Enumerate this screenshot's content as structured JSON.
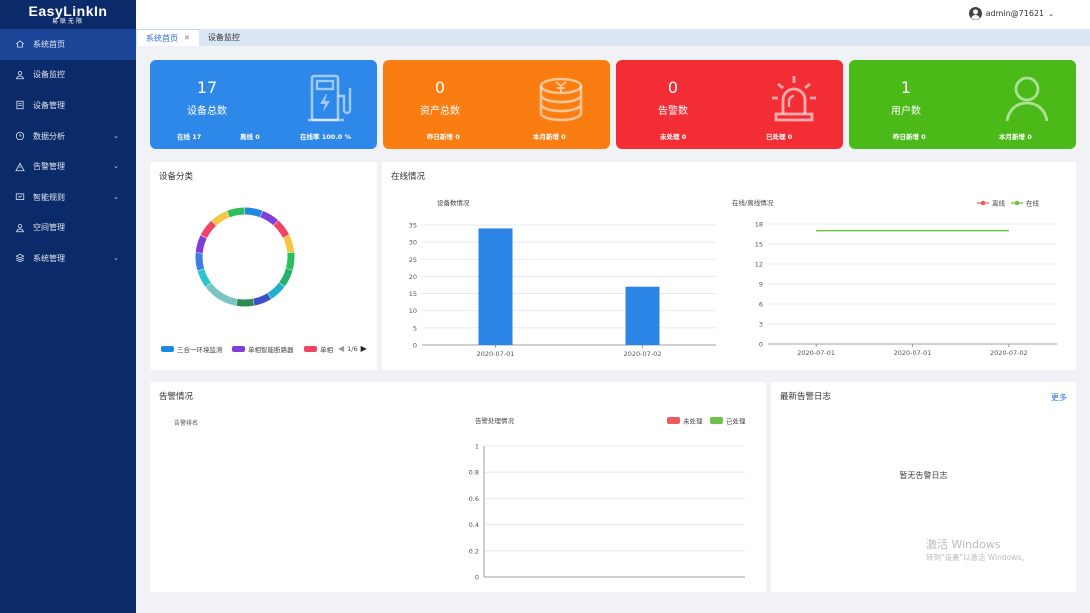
{
  "logo": {
    "main": "EasyLinkIn",
    "sub": "易联无限"
  },
  "sidebar": {
    "items": [
      {
        "label": "系统首页",
        "icon": "home-icon",
        "has_children": false,
        "active": true
      },
      {
        "label": "设备监控",
        "icon": "user-icon",
        "has_children": false
      },
      {
        "label": "设备管理",
        "icon": "document-icon",
        "has_children": false
      },
      {
        "label": "数据分析",
        "icon": "clock-icon",
        "has_children": true
      },
      {
        "label": "告警管理",
        "icon": "warning-icon",
        "has_children": true
      },
      {
        "label": "智能规则",
        "icon": "monitor-icon",
        "has_children": true
      },
      {
        "label": "空间管理",
        "icon": "user-icon",
        "has_children": false
      },
      {
        "label": "系统管理",
        "icon": "layers-icon",
        "has_children": true
      }
    ]
  },
  "header": {
    "user": "admin@71621"
  },
  "tabs": [
    {
      "label": "系统首页",
      "closable": true,
      "active": true
    },
    {
      "label": "设备监控",
      "closable": false
    }
  ],
  "cards": [
    {
      "value": "17",
      "label": "设备总数",
      "color": "#2d88ea",
      "icon": "charging-station-icon",
      "sub_left": "在线 17",
      "sub_mid": "离线 0",
      "sub_right": "在线率 100.0 %"
    },
    {
      "value": "0",
      "label": "资产总数",
      "color": "#fa7d12",
      "icon": "coins-icon",
      "sub_left": "昨日新增 0",
      "sub_right": "本月新增 0"
    },
    {
      "value": "0",
      "label": "告警数",
      "color": "#f32d34",
      "icon": "alarm-light-icon",
      "sub_left": "未处理 0",
      "sub_right": "已处理 0"
    },
    {
      "value": "1",
      "label": "用户数",
      "color": "#4bba18",
      "icon": "user-icon",
      "sub_left": "昨日新增 0",
      "sub_right": "本月新增 0"
    }
  ],
  "device_category": {
    "title": "设备分类",
    "legend": [
      {
        "name": "三合一环境监测",
        "color": "#1e88e5"
      },
      {
        "name": "单相智能断路器",
        "color": "#7e3fd8"
      },
      {
        "name": "单相",
        "color": "#ee4466"
      }
    ],
    "page": "1/6"
  },
  "online": {
    "title": "在线情况"
  },
  "alarm": {
    "title": "告警情况",
    "rank_label": "告警排名",
    "legend": [
      {
        "name": "未处理",
        "color": "#f05b5b"
      },
      {
        "name": "已处理",
        "color": "#6cc24a"
      }
    ]
  },
  "logs": {
    "title": "最新告警日志",
    "more": "更多",
    "empty": "暂无告警日志"
  },
  "watermark": {
    "line1": "激活 Windows",
    "line2": "转到\"设置\"以激活 Windows。"
  },
  "chart_data": [
    {
      "type": "pie",
      "title": "",
      "donut": true,
      "slices": [
        {
          "color": "#1e88e5",
          "value": 1
        },
        {
          "color": "#7e3fd8",
          "value": 1
        },
        {
          "color": "#ee4466",
          "value": 1
        },
        {
          "color": "#f7c744",
          "value": 1
        },
        {
          "color": "#2bbf5c",
          "value": 1
        },
        {
          "color": "#23b26d",
          "value": 1
        },
        {
          "color": "#1fb1c9",
          "value": 1
        },
        {
          "color": "#3c51c9",
          "value": 1
        },
        {
          "color": "#2e8b57",
          "value": 1
        },
        {
          "color": "#7cc4c0",
          "value": 2
        },
        {
          "color": "#2bc6cf",
          "value": 1
        },
        {
          "color": "#3c7ee6",
          "value": 1
        },
        {
          "color": "#7e3fd8",
          "value": 1
        },
        {
          "color": "#ee4466",
          "value": 1
        },
        {
          "color": "#f7c744",
          "value": 1
        },
        {
          "color": "#2bbf5c",
          "value": 1
        }
      ]
    },
    {
      "type": "bar",
      "title": "设备数情况",
      "categories": [
        "2020-07-01",
        "2020-07-02"
      ],
      "values": [
        34,
        17
      ],
      "ylim": [
        0,
        35
      ],
      "yticks": [
        0,
        5,
        10,
        15,
        20,
        25,
        30,
        35
      ],
      "color": "#2b85e6"
    },
    {
      "type": "line",
      "title": "在线/离线情况",
      "categories": [
        "2020-07-01",
        "2020-07-01",
        "2020-07-02"
      ],
      "ylim": [
        0,
        18
      ],
      "yticks": [
        0,
        3,
        6,
        9,
        12,
        15,
        18
      ],
      "series": [
        {
          "name": "离线",
          "color": "#f05b5b",
          "values": []
        },
        {
          "name": "在线",
          "color": "#6cc24a",
          "values": [
            17,
            17,
            17
          ]
        }
      ]
    },
    {
      "type": "bar",
      "title": "告警处理情况",
      "categories": [],
      "ylim": [
        0,
        1
      ],
      "yticks": [
        0,
        0.2,
        0.4,
        0.6,
        0.8,
        1
      ],
      "series": [
        {
          "name": "未处理",
          "values": []
        },
        {
          "name": "已处理",
          "values": []
        }
      ]
    }
  ]
}
